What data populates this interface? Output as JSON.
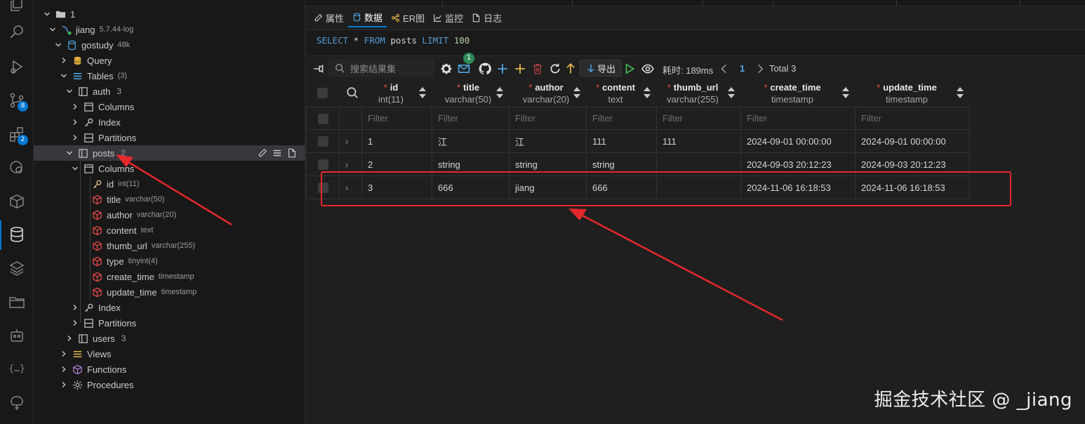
{
  "colors": {
    "accent": "#0078d4",
    "annotation": "#e5282a",
    "key_icon": "#e2c08d",
    "column_icon": "#f14c4c",
    "table_icon": "#c5c5c5"
  },
  "activity": {
    "badge_source_control": "8",
    "badge_extensions": "2"
  },
  "tree": {
    "connection_group": "1",
    "connection": {
      "name": "jiang",
      "desc": "5.7.44-log"
    },
    "database": {
      "name": "gostudy",
      "desc": "48k"
    },
    "query": "Query",
    "tables": {
      "label": "Tables",
      "count": "(3)"
    },
    "auth": {
      "name": "auth",
      "count": "3",
      "columns": "Columns",
      "index": "Index",
      "partitions": "Partitions"
    },
    "posts": {
      "name": "posts",
      "count": "2",
      "columns_label": "Columns",
      "columns": [
        {
          "name": "id",
          "type": "int(11)",
          "icon": "key-icon"
        },
        {
          "name": "title",
          "type": "varchar(50)",
          "icon": "column-icon"
        },
        {
          "name": "author",
          "type": "varchar(20)",
          "icon": "column-icon"
        },
        {
          "name": "content",
          "type": "text",
          "icon": "column-icon"
        },
        {
          "name": "thumb_url",
          "type": "varchar(255)",
          "icon": "column-icon"
        },
        {
          "name": "type",
          "type": "tinyint(4)",
          "icon": "column-icon"
        },
        {
          "name": "create_time",
          "type": "timestamp",
          "icon": "column-icon"
        },
        {
          "name": "update_time",
          "type": "timestamp",
          "icon": "column-icon"
        }
      ],
      "index": "Index",
      "partitions": "Partitions"
    },
    "users": {
      "name": "users",
      "count": "3"
    },
    "views": "Views",
    "functions": "Functions",
    "procedures": "Procedures"
  },
  "tabs": [
    {
      "label": "属性",
      "icon": "pencil-icon"
    },
    {
      "label": "数据",
      "icon": "database-icon"
    },
    {
      "label": "ER图",
      "icon": "er-icon"
    },
    {
      "label": "监控",
      "icon": "chart-icon"
    },
    {
      "label": "日志",
      "icon": "file-icon"
    }
  ],
  "sql": {
    "select": "SELECT",
    "star": " * ",
    "from": "FROM",
    "table": " posts ",
    "limit": "LIMIT",
    "value": " 100"
  },
  "toolbar": {
    "search_placeholder": "搜索结果集",
    "mail_badge": "1",
    "export_label": "导出",
    "elapsed": "耗时: 189ms",
    "page": "1",
    "total": "Total 3"
  },
  "grid": {
    "columns": [
      {
        "name": "id",
        "type": "int(11)"
      },
      {
        "name": "title",
        "type": "varchar(50)"
      },
      {
        "name": "author",
        "type": "varchar(20)"
      },
      {
        "name": "content",
        "type": "text"
      },
      {
        "name": "thumb_url",
        "type": "varchar(255)"
      },
      {
        "name": "create_time",
        "type": "timestamp"
      },
      {
        "name": "update_time",
        "type": "timestamp"
      }
    ],
    "required_mark": "*",
    "filter_placeholder": "Filter",
    "rows": [
      [
        "1",
        "江",
        "江",
        "111",
        "111",
        "2024-09-01 00:00:00",
        "2024-09-01 00:00:00"
      ],
      [
        "2",
        "string",
        "string",
        "string",
        "",
        "2024-09-03 20:12:23",
        "2024-09-03 20:12:23"
      ],
      [
        "3",
        "666",
        "jiang",
        "666",
        "",
        "2024-11-06 16:18:53",
        "2024-11-06 16:18:53"
      ]
    ]
  },
  "watermark": "掘金技术社区 @ _jiang"
}
